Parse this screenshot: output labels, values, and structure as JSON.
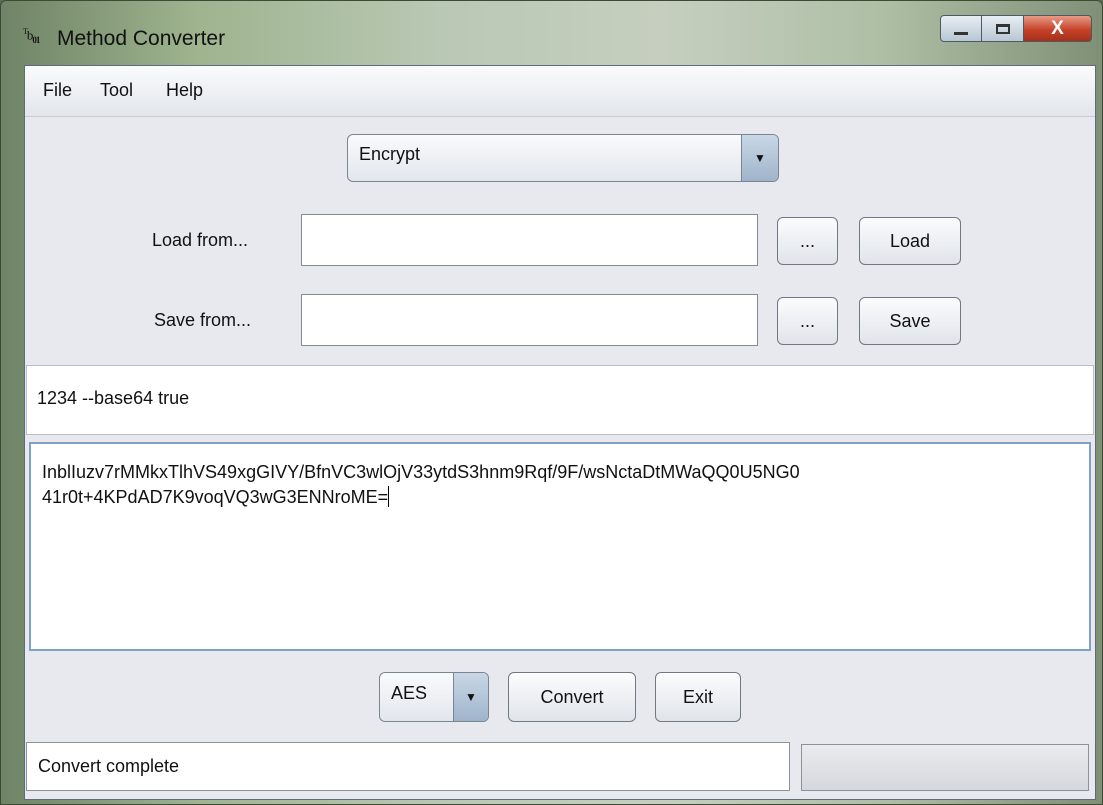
{
  "window": {
    "title": "Method Converter",
    "icon_text": {
      "sup": "T",
      "main": "b",
      "sub": "01"
    },
    "caption_buttons": {
      "minimize_icon": "minimize-icon",
      "maximize_icon": "maximize-icon",
      "close_icon": "close-icon",
      "close_glyph": "X"
    }
  },
  "menubar": {
    "items": [
      "File",
      "Tool",
      "Help"
    ]
  },
  "mode_select": {
    "value": "Encrypt",
    "arrow": "▼"
  },
  "load": {
    "label": "Load from...",
    "value": "",
    "browse_label": "...",
    "action_label": "Load"
  },
  "save": {
    "label": "Save from...",
    "value": "",
    "browse_label": "...",
    "action_label": "Save"
  },
  "arguments": {
    "value": "1234 --base64 true"
  },
  "output": {
    "value": "InblIuzv7rMMkxTlhVS49xgGIVY/BfnVC3wlOjV33ytdS3hnm9Rqf/9F/wsNctaDtMWaQQ0U5NG0\n41r0t+4KPdAD7K9voqVQ3wG3ENNroME="
  },
  "bottom": {
    "algorithm": "AES",
    "arrow": "▼",
    "convert_label": "Convert",
    "exit_label": "Exit"
  },
  "status": {
    "text": "Convert complete",
    "progress": 0
  },
  "colors": {
    "accent": "#7ea1c4",
    "close": "#c6422a"
  }
}
